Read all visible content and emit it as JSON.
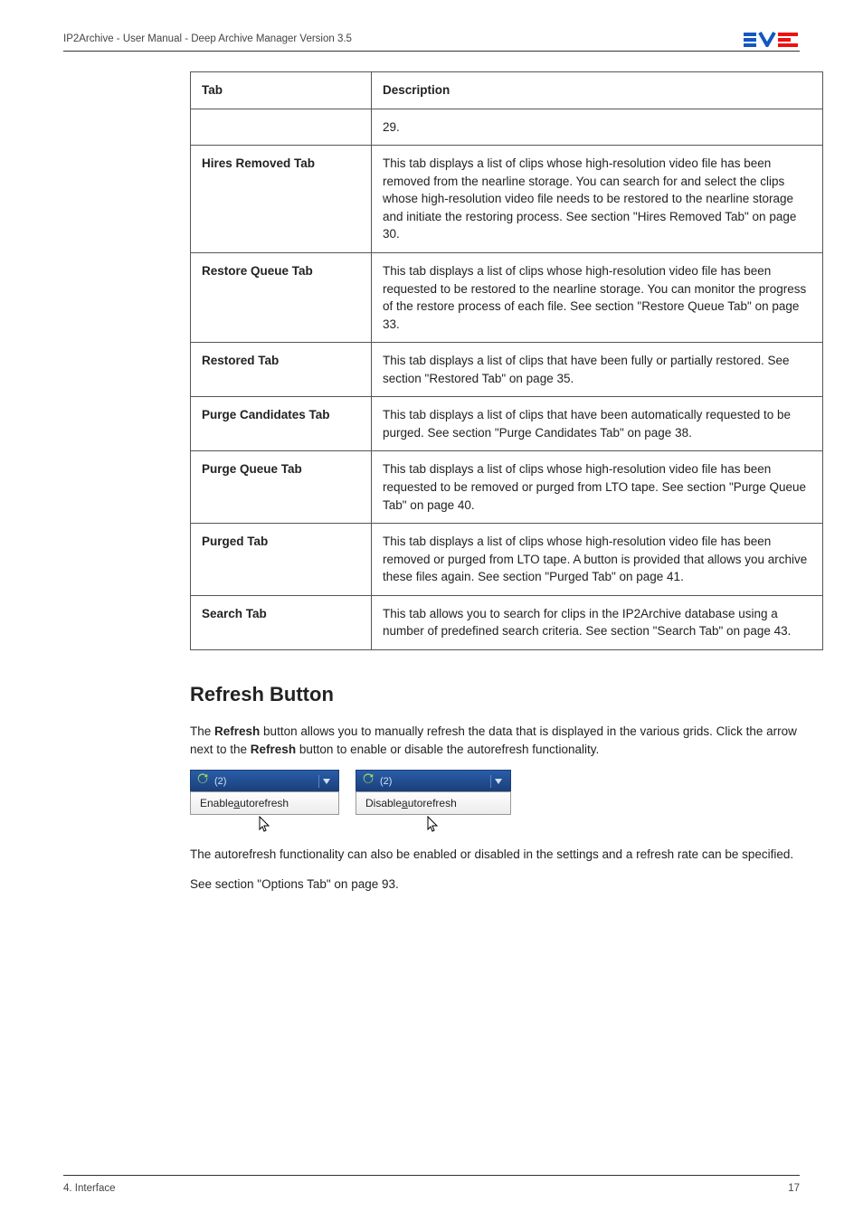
{
  "header": {
    "doc_title": "IP2Archive - User Manual - Deep Archive Manager Version 3.5"
  },
  "table": {
    "head_tab": "Tab",
    "head_desc": "Description",
    "first_desc": "29.",
    "rows": [
      {
        "tab": "Hires Removed Tab",
        "desc": "This tab displays a list of clips whose high-resolution video file has been removed from the nearline storage. You can search for and select the clips whose high-resolution video file needs to be restored to the nearline storage and initiate the restoring process. See section \"Hires Removed Tab\" on page 30."
      },
      {
        "tab": "Restore Queue Tab",
        "desc": "This tab displays a list of clips whose high-resolution video file has been requested to be restored to the nearline storage. You can monitor the progress of the restore process of each file. See section \"Restore Queue Tab\" on page 33."
      },
      {
        "tab": "Restored Tab",
        "desc": "This tab displays a list of clips that have been fully or partially restored. See section \"Restored Tab\" on page 35."
      },
      {
        "tab": "Purge Candidates Tab",
        "desc": "This tab displays a list of clips that have been automatically requested to be purged. See section \"Purge Candidates Tab\" on page 38."
      },
      {
        "tab": "Purge Queue Tab",
        "desc": "This tab displays a list of clips whose high-resolution video file has been requested to be removed or purged from LTO tape. See section \"Purge Queue Tab\" on page 40."
      },
      {
        "tab": "Purged Tab",
        "desc": "This tab displays a list of clips whose high-resolution video file has been removed or purged from LTO tape. A button is provided that allows you archive these files again. See section \"Purged Tab\" on page 41."
      },
      {
        "tab": "Search Tab",
        "desc": "This tab allows you to search for clips in the IP2Archive database using a number of predefined search criteria. See section \"Search Tab\" on page 43."
      }
    ]
  },
  "section": {
    "title": "Refresh Button"
  },
  "paragraphs": {
    "p1_a": "The ",
    "p1_b1": "Refresh",
    "p1_b": " button allows you to manually refresh the data that is displayed in the various grids. Click the arrow next to the ",
    "p1_b2": "Refresh",
    "p1_c": " button to enable or disable the autorefresh functionality.",
    "p2": "The autorefresh functionality can also be enabled or disabled in the settings and a refresh rate can be specified.",
    "p3": "See section \"Options Tab\" on page 93."
  },
  "menu": {
    "left": {
      "count_label": "(2)",
      "item_prefix": "Enable ",
      "item_underline": "a",
      "item_suffix": "utorefresh"
    },
    "right": {
      "count_label": "(2)",
      "item_prefix": "Disable ",
      "item_underline": "a",
      "item_suffix": "utorefresh"
    }
  },
  "footer": {
    "left": "4. Interface",
    "right": "17"
  }
}
